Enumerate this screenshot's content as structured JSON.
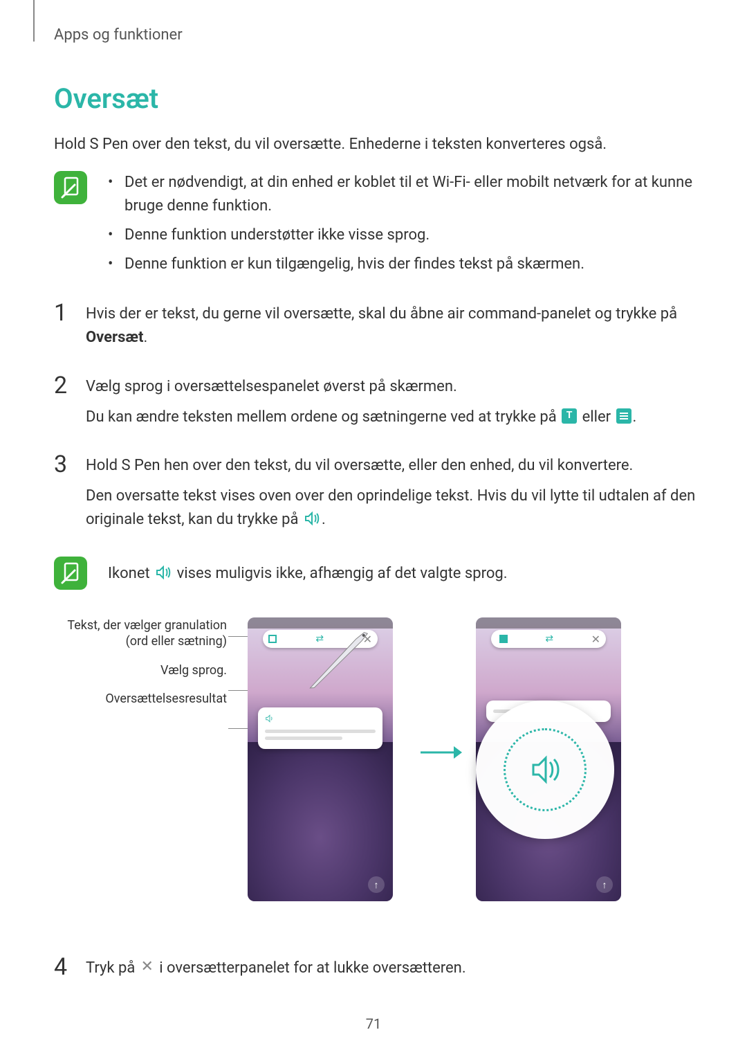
{
  "breadcrumb": "Apps og funktioner",
  "title": "Oversæt",
  "intro": "Hold S Pen over den tekst, du vil oversætte. Enhederne i teksten konverteres også.",
  "notes": {
    "items": [
      "Det er nødvendigt, at din enhed er koblet til et Wi-Fi- eller mobilt netværk for at kunne bruge denne funktion.",
      "Denne funktion understøtter ikke visse sprog.",
      "Denne funktion er kun tilgængelig, hvis der findes tekst på skærmen."
    ]
  },
  "steps": {
    "s1": {
      "num": "1",
      "pre": "Hvis der er tekst, du gerne vil oversætte, skal du åbne air command-panelet og trykke på ",
      "bold": "Oversæt",
      "post": "."
    },
    "s2": {
      "num": "2",
      "line1": "Vælg sprog i oversættelsespanelet øverst på skærmen.",
      "line2_pre": "Du kan ændre teksten mellem ordene og sætningerne ved at trykke på ",
      "line2_mid": " eller ",
      "line2_post": "."
    },
    "s3": {
      "num": "3",
      "line1": "Hold S Pen hen over den tekst, du vil oversætte, eller den enhed, du vil konvertere.",
      "line2_pre": "Den oversatte tekst vises oven over den oprindelige tekst. Hvis du vil lytte til udtalen af den originale tekst, kan du trykke på ",
      "line2_post": "."
    },
    "s4": {
      "num": "4",
      "pre": "Tryk på ",
      "post": " i oversætterpanelet for at lukke oversætteren."
    }
  },
  "note2": {
    "pre": "Ikonet ",
    "post": " vises muligvis ikke, afhængig af det valgte sprog."
  },
  "callouts": {
    "c1": "Tekst, der vælger granulation (ord eller sætning)",
    "c2": "Vælg sprog.",
    "c3": "Oversættelsesresultat"
  },
  "page_number": "71"
}
